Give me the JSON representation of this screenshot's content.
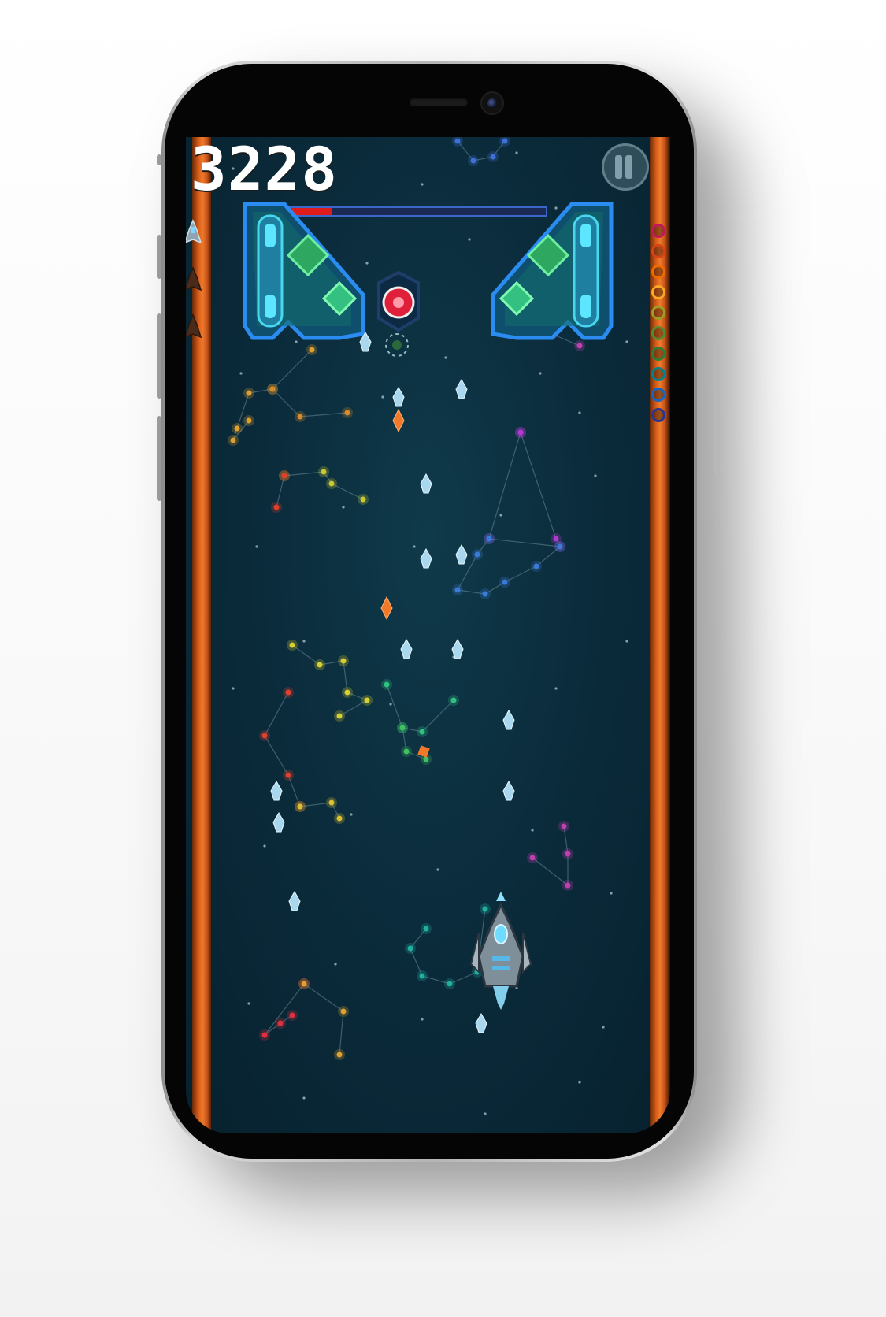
{
  "hud": {
    "score": "3228",
    "boss_health_fraction": 0.2,
    "lives_total": 3,
    "lives_remaining": 1
  },
  "combo_meter": {
    "colors": [
      "#c2185b",
      "#d84315",
      "#ef6c00",
      "#f9a825",
      "#9e9d24",
      "#558b2f",
      "#2e7d32",
      "#00838f",
      "#1565c0",
      "#283593"
    ]
  },
  "colors": {
    "rail": "#f07a2a",
    "space": "#0b2c3c",
    "boss_frame": "#2a8cf0",
    "boss_core": "#e0203a",
    "player_bullet": "#a9d8ee",
    "enemy_bullet": "#f07a2a"
  },
  "icons": {
    "pause": "pause-icon",
    "life": "ship-life-icon",
    "player": "player-ship-icon",
    "boss": "boss-ship-icon"
  }
}
